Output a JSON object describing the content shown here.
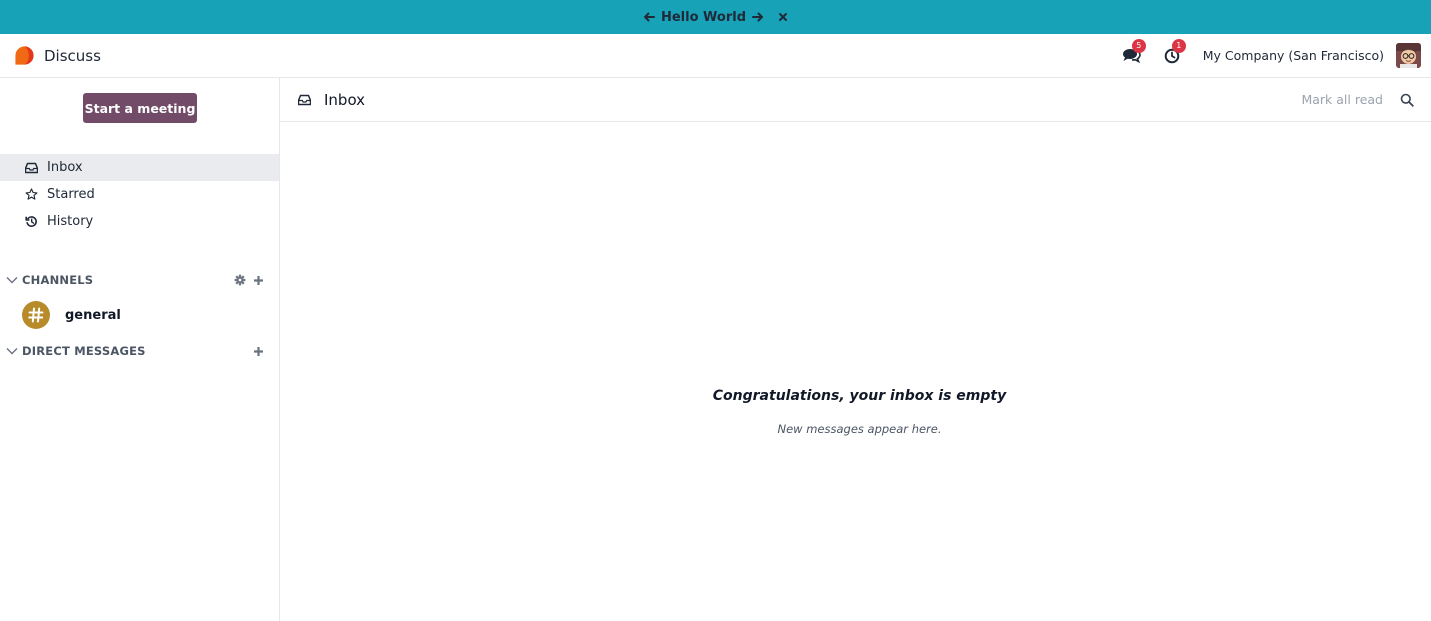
{
  "tour": {
    "title": "Hello World"
  },
  "app": {
    "name": "Discuss"
  },
  "navbar": {
    "messages_badge": "5",
    "activities_badge": "1",
    "company": "My Company (San Francisco)"
  },
  "sidebar": {
    "start_meeting": "Start a meeting",
    "mailboxes": [
      {
        "label": "Inbox"
      },
      {
        "label": "Starred"
      },
      {
        "label": "History"
      }
    ],
    "channels_label": "CHANNELS",
    "channels": [
      {
        "name": "general"
      }
    ],
    "direct_messages_label": "DIRECT MESSAGES"
  },
  "main": {
    "title": "Inbox",
    "mark_all_read": "Mark all read",
    "empty_title": "Congratulations, your inbox is empty",
    "empty_subtitle": "New messages appear here."
  },
  "colors": {
    "tour_bar": "#17a2b8",
    "primary": "#714b67",
    "badge": "#dc3545",
    "channel_avatar": "#b78a2a"
  }
}
